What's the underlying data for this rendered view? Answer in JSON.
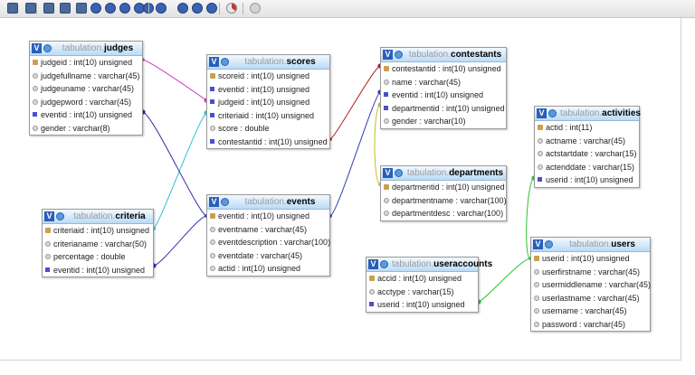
{
  "toolbar": {
    "icons": [
      "toggle-icon",
      "fullscreen-icon",
      "save-icon",
      "list-icon",
      "music-note-icon",
      "circle-icon",
      "help-circle-icon",
      "refresh-icon",
      "info-icon",
      "toggle-small-icon",
      "zoom-in-icon",
      "zoom-out-icon",
      "edit-icon",
      "print-icon",
      "pie-chart-icon",
      "arrow-icon"
    ]
  },
  "db_prefix": "tabulation",
  "tables": {
    "judges": {
      "name": "judges",
      "columns": [
        {
          "icon": "key",
          "text": "judgeid : int(10) unsigned"
        },
        {
          "icon": "plain",
          "text": "judgefullname : varchar(45)"
        },
        {
          "icon": "plain",
          "text": "judgeuname : varchar(45)"
        },
        {
          "icon": "plain",
          "text": "judgepword : varchar(45)"
        },
        {
          "icon": "idx",
          "text": "eventid : int(10) unsigned"
        },
        {
          "icon": "plain",
          "text": "gender : varchar(8)"
        }
      ]
    },
    "scores": {
      "name": "scores",
      "columns": [
        {
          "icon": "key",
          "text": "scoreid : int(10) unsigned"
        },
        {
          "icon": "idx",
          "text": "eventid : int(10) unsigned"
        },
        {
          "icon": "idx",
          "text": "judgeid : int(10) unsigned"
        },
        {
          "icon": "idx",
          "text": "criteriaid : int(10) unsigned"
        },
        {
          "icon": "plain",
          "text": "score : double"
        },
        {
          "icon": "idx",
          "text": "contestantid : int(10) unsigned"
        }
      ]
    },
    "contestants": {
      "name": "contestants",
      "columns": [
        {
          "icon": "key",
          "text": "contestantid : int(10) unsigned"
        },
        {
          "icon": "plain",
          "text": "name : varchar(45)"
        },
        {
          "icon": "idx",
          "text": "eventid : int(10) unsigned"
        },
        {
          "icon": "idx",
          "text": "departmentid : int(10) unsigned"
        },
        {
          "icon": "plain",
          "text": "gender : varchar(10)"
        }
      ]
    },
    "activities": {
      "name": "activities",
      "columns": [
        {
          "icon": "key",
          "text": "actid : int(11)"
        },
        {
          "icon": "plain",
          "text": "actname : varchar(45)"
        },
        {
          "icon": "plain",
          "text": "actstartdate : varchar(15)"
        },
        {
          "icon": "plain",
          "text": "actenddate : varchar(15)"
        },
        {
          "icon": "idx",
          "text": "userid : int(10) unsigned"
        }
      ]
    },
    "departments": {
      "name": "departments",
      "columns": [
        {
          "icon": "key",
          "text": "departmentid : int(10) unsigned"
        },
        {
          "icon": "plain",
          "text": "departmentname : varchar(100)"
        },
        {
          "icon": "plain",
          "text": "departmentdesc : varchar(100)"
        }
      ]
    },
    "criteria": {
      "name": "criteria",
      "columns": [
        {
          "icon": "key",
          "text": "criteriaid : int(10) unsigned"
        },
        {
          "icon": "plain",
          "text": "criterianame : varchar(50)"
        },
        {
          "icon": "plain",
          "text": "percentage : double"
        },
        {
          "icon": "idx",
          "text": "eventid : int(10) unsigned"
        }
      ]
    },
    "events": {
      "name": "events",
      "columns": [
        {
          "icon": "key",
          "text": "eventid : int(10) unsigned"
        },
        {
          "icon": "plain",
          "text": "eventname : varchar(45)"
        },
        {
          "icon": "plain",
          "text": "eventdescription : varchar(100)"
        },
        {
          "icon": "plain",
          "text": "eventdate : varchar(45)"
        },
        {
          "icon": "plain",
          "text": "actid : int(10) unsigned"
        }
      ]
    },
    "useraccounts": {
      "name": "useraccounts",
      "columns": [
        {
          "icon": "key",
          "text": "accid : int(10) unsigned"
        },
        {
          "icon": "plain",
          "text": "acctype : varchar(15)"
        },
        {
          "icon": "idx",
          "text": "userid : int(10) unsigned"
        }
      ]
    },
    "users": {
      "name": "users",
      "columns": [
        {
          "icon": "key",
          "text": "userid : int(10) unsigned"
        },
        {
          "icon": "plain",
          "text": "userfirstname : varchar(45)"
        },
        {
          "icon": "plain",
          "text": "usermiddlename : varchar(45)"
        },
        {
          "icon": "plain",
          "text": "userlastname : varchar(45)"
        },
        {
          "icon": "plain",
          "text": "username : varchar(45)"
        },
        {
          "icon": "plain",
          "text": "password : varchar(45)"
        }
      ]
    }
  },
  "relation_colors": {
    "judges_scores": "#d040c0",
    "criteria_scores": "#30c0d8",
    "contestants_scores": "#b02020",
    "events_judges": "#2a2aa0",
    "events_criteria": "#3030c0",
    "events_contestants": "#3040b0",
    "departments_contestants": "#c0c020",
    "users_accounts": "#30c030"
  }
}
